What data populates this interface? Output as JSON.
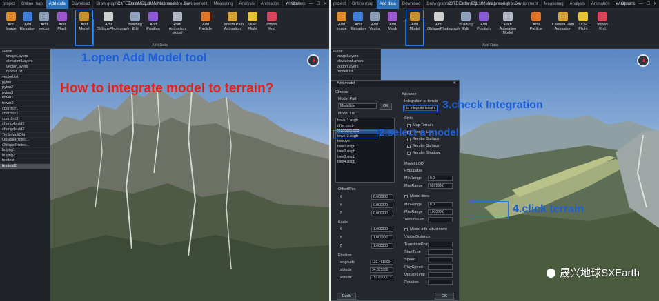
{
  "left": {
    "tabs": [
      "project",
      "Online map",
      "Add data",
      "Download",
      "Draw graphics",
      "Color Adjust",
      "Map model",
      "Environment",
      "Measuring",
      "Analysis",
      "Animation",
      "Window"
    ],
    "active_tab": "Add data",
    "window_title": "C:\\TEEarthNE\\1.1\\Maha\\1ness_pro.sxe ...",
    "window_controls": [
      "▾",
      "Options",
      "—",
      "☐",
      "✕"
    ],
    "ribbon": [
      {
        "label": "Add\nImage",
        "icon": "image-icon",
        "color": "#e08a2e"
      },
      {
        "label": "Add\nElevation",
        "icon": "elevation-icon",
        "color": "#3f7fd9"
      },
      {
        "label": "Add\nVector",
        "icon": "vector-icon",
        "color": "#8a9cb5"
      },
      {
        "label": "Add\nMask",
        "icon": "mask-icon",
        "color": "#9b59d0"
      },
      {
        "label": "Add\nModel",
        "icon": "model-icon",
        "color": "#c8902c"
      },
      {
        "label": "Add\nObliquePhotograph",
        "icon": "oblique-icon",
        "color": "#cfcfcf"
      },
      {
        "label": "Building\nEdit",
        "icon": "building-icon",
        "color": "#8fa2bd"
      },
      {
        "label": "Add\nPosition",
        "icon": "position-icon",
        "color": "#8b5bd8"
      },
      {
        "label": "Path Animation\nModel",
        "icon": "path-animation-icon",
        "color": "#b0b7c2"
      },
      {
        "label": "Add\nParticle",
        "icon": "particle-icon",
        "color": "#e0762a"
      },
      {
        "label": "Camera Path\nAnimation",
        "icon": "camera-path-icon",
        "color": "#d7a23b"
      },
      {
        "label": "UDP\nFlight",
        "icon": "flight-icon",
        "color": "#e6c43a"
      },
      {
        "label": "Import\nKml",
        "icon": "kml-icon",
        "color": "#d9455a"
      }
    ],
    "ribbon_group": "Add Data",
    "tree": [
      "scene",
      "imageLayers",
      "elevationLayers",
      "vectorLayers",
      "modelList",
      "vectorList",
      "pylon1",
      "pylon2",
      "pylon3",
      "tower1",
      "tower2",
      "coordfor1",
      "coordfor2",
      "coordfor3",
      "chongxbuild1",
      "chongxbuild2",
      "TieSeMultObj",
      "ObliqueProtec...",
      "ObliqueProtec...",
      "buijing1",
      "buijing2",
      "texttest",
      "texttest2"
    ],
    "anno1": "1.open Add Model tool",
    "question": "How to integrate model to terrain?"
  },
  "right": {
    "tabs": [
      "project",
      "Online map",
      "Add data",
      "Download",
      "Draw graphics",
      "Color Adjust",
      "Map model",
      "Environment",
      "Measuring",
      "Analysis",
      "Animation",
      "Window"
    ],
    "active_tab": "Add data",
    "window_title": "C:\\TEEarthNE\\1.1\\Maha\\1ness_pro.sxe ...",
    "window_controls": [
      "▾",
      "Options",
      "—",
      "☐",
      "✕"
    ],
    "ribbon": [
      {
        "label": "Add\nImage",
        "icon": "image-icon",
        "color": "#e08a2e"
      },
      {
        "label": "Add\nElevation",
        "icon": "elevation-icon",
        "color": "#3f7fd9"
      },
      {
        "label": "Add\nVector",
        "icon": "vector-icon",
        "color": "#8a9cb5"
      },
      {
        "label": "Add\nMask",
        "icon": "mask-icon",
        "color": "#9b59d0"
      },
      {
        "label": "Add\nModel",
        "icon": "model-icon",
        "color": "#c8902c"
      },
      {
        "label": "Add\nObliquePhotograph",
        "icon": "oblique-icon",
        "color": "#cfcfcf"
      },
      {
        "label": "Building\nEdit",
        "icon": "building-icon",
        "color": "#8fa2bd"
      },
      {
        "label": "Add\nPosition",
        "icon": "position-icon",
        "color": "#8b5bd8"
      },
      {
        "label": "Path Animation\nModel",
        "icon": "path-animation-icon",
        "color": "#b0b7c2"
      },
      {
        "label": "Add\nParticle",
        "icon": "particle-icon",
        "color": "#e0762a"
      },
      {
        "label": "Camera Path\nAnimation",
        "icon": "camera-path-icon",
        "color": "#d7a23b"
      },
      {
        "label": "UDP\nFlight",
        "icon": "flight-icon",
        "color": "#e6c43a"
      },
      {
        "label": "Import\nKml",
        "icon": "kml-icon",
        "color": "#d9455a"
      }
    ],
    "ribbon_group": "Add Data",
    "tree": [
      "scene",
      "imageLayers",
      "elevationLayers",
      "vectorLayers",
      "modelList"
    ],
    "dialog": {
      "title": "Add model",
      "close": "✕",
      "left_section": "Choose",
      "model_path_label": "Model Path",
      "model_path_value": "Modelbin/",
      "browse": "OK",
      "model_list_label": "Model List",
      "models": [
        "tower1.osgb",
        "dfile.osgb",
        "markpos.osg",
        "tower2.osgb",
        "tree.ive",
        "tree1.osgb",
        "tree2.osgb",
        "tree3.osgb",
        "tree4.osgb"
      ],
      "selected_model": "markpos.osg",
      "offset_label": "Offset/Pos",
      "offset": {
        "x": "0.000000",
        "y": "0.000000",
        "z": "0.000000"
      },
      "scale_label": "Scale",
      "scale": {
        "x": "1.000000",
        "y": "1.000000",
        "z": "1.000000"
      },
      "position_label": "Position",
      "longitude_label": "longitude",
      "longitude": "123.461900",
      "latitude_label": "latitude",
      "latitude": "34.825998",
      "altitude_label": "altitude",
      "altitude": "1532.0000",
      "right_section": "Advance",
      "integrate_label": "Integration to terrain",
      "integrate_option": "to Integrate terrain",
      "style_label": "Style",
      "styles": [
        "Map Terrain",
        "Render Line",
        "Render Surface",
        "Render Surface",
        "Render Shadow"
      ],
      "model_lod_label": "Model LOD",
      "popupable": "Popupable",
      "min_range_label": "MinRange",
      "min_range": "0.0",
      "max_range_label": "MaxRange",
      "max_range": "999999.0",
      "model_lines_label": "Model lines",
      "min_range2": "0.0",
      "max_range2": "100000.0",
      "textures_label": "TexturePath",
      "model_info_label": "Model info adjustment",
      "visible_distance": "VisibleDistance",
      "params": [
        "TransitionPoint",
        "StartTime",
        "Speed",
        "PlaySpeed",
        "UpdateTime",
        "Rotation"
      ],
      "ok": "OK",
      "cancel": "Back"
    },
    "anno2": "2.select a model",
    "anno3": "3.check Integration",
    "anno4": "4.click terrain",
    "watermark": "晟兴地球SXEarth"
  },
  "colors": {
    "anno_blue": "#1d5fd6",
    "anno_red": "#e0241b",
    "highlight": "#2f6fd8"
  }
}
